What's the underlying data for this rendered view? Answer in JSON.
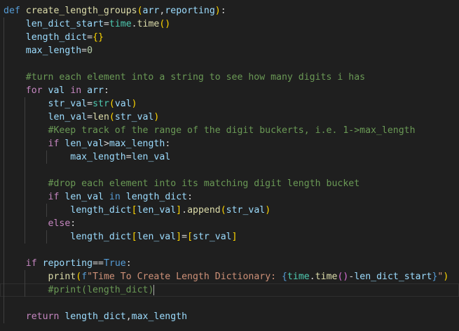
{
  "colors": {
    "background": "#1f1f1f",
    "keyword": "#569cd6",
    "control": "#c586c0",
    "function": "#dcdcaa",
    "variable": "#9cdcfe",
    "plain": "#d4d4d4",
    "string": "#ce9178",
    "number": "#b5cea8",
    "comment": "#6a9955",
    "bracket1": "#ffd700",
    "bracket2": "#da70d6",
    "bracket3": "#179fff",
    "type": "#4ec9b0"
  },
  "editor": {
    "language": "python",
    "cursor_line": 22,
    "lines": [
      {
        "indent": 0,
        "tokens": [
          {
            "t": "def",
            "c": "keyword"
          },
          {
            "t": " ",
            "c": "plain"
          },
          {
            "t": "create_length_groups",
            "c": "function"
          },
          {
            "t": "(",
            "c": "bracket1"
          },
          {
            "t": "arr",
            "c": "variable"
          },
          {
            "t": ",",
            "c": "plain"
          },
          {
            "t": "reporting",
            "c": "variable"
          },
          {
            "t": ")",
            "c": "bracket1"
          },
          {
            "t": ":",
            "c": "plain"
          }
        ]
      },
      {
        "indent": 1,
        "tokens": [
          {
            "t": "len_dict_start",
            "c": "variable"
          },
          {
            "t": "=",
            "c": "plain"
          },
          {
            "t": "time",
            "c": "type"
          },
          {
            "t": ".",
            "c": "plain"
          },
          {
            "t": "time",
            "c": "function"
          },
          {
            "t": "()",
            "c": "bracket1"
          }
        ]
      },
      {
        "indent": 1,
        "tokens": [
          {
            "t": "length_dict",
            "c": "variable"
          },
          {
            "t": "=",
            "c": "plain"
          },
          {
            "t": "{}",
            "c": "bracket1"
          }
        ]
      },
      {
        "indent": 1,
        "tokens": [
          {
            "t": "max_length",
            "c": "variable"
          },
          {
            "t": "=",
            "c": "plain"
          },
          {
            "t": "0",
            "c": "number"
          }
        ]
      },
      {
        "indent": 1,
        "tokens": []
      },
      {
        "indent": 1,
        "tokens": [
          {
            "t": "#turn each element into a string to see how many digits i has",
            "c": "comment"
          }
        ]
      },
      {
        "indent": 1,
        "tokens": [
          {
            "t": "for",
            "c": "control"
          },
          {
            "t": " ",
            "c": "plain"
          },
          {
            "t": "val",
            "c": "variable"
          },
          {
            "t": " ",
            "c": "plain"
          },
          {
            "t": "in",
            "c": "control"
          },
          {
            "t": " ",
            "c": "plain"
          },
          {
            "t": "arr",
            "c": "variable"
          },
          {
            "t": ":",
            "c": "plain"
          }
        ]
      },
      {
        "indent": 2,
        "tokens": [
          {
            "t": "str_val",
            "c": "variable"
          },
          {
            "t": "=",
            "c": "plain"
          },
          {
            "t": "str",
            "c": "type"
          },
          {
            "t": "(",
            "c": "bracket1"
          },
          {
            "t": "val",
            "c": "variable"
          },
          {
            "t": ")",
            "c": "bracket1"
          }
        ]
      },
      {
        "indent": 2,
        "tokens": [
          {
            "t": "len_val",
            "c": "variable"
          },
          {
            "t": "=",
            "c": "plain"
          },
          {
            "t": "len",
            "c": "function"
          },
          {
            "t": "(",
            "c": "bracket1"
          },
          {
            "t": "str_val",
            "c": "variable"
          },
          {
            "t": ")",
            "c": "bracket1"
          }
        ]
      },
      {
        "indent": 2,
        "tokens": [
          {
            "t": "#Keep track of the range of the digit buckerts, i.e. 1->max_length",
            "c": "comment"
          }
        ]
      },
      {
        "indent": 2,
        "tokens": [
          {
            "t": "if",
            "c": "control"
          },
          {
            "t": " ",
            "c": "plain"
          },
          {
            "t": "len_val",
            "c": "variable"
          },
          {
            "t": ">",
            "c": "plain"
          },
          {
            "t": "max_length",
            "c": "variable"
          },
          {
            "t": ":",
            "c": "plain"
          }
        ]
      },
      {
        "indent": 3,
        "tokens": [
          {
            "t": "max_length",
            "c": "variable"
          },
          {
            "t": "=",
            "c": "plain"
          },
          {
            "t": "len_val",
            "c": "variable"
          }
        ]
      },
      {
        "indent": 2,
        "tokens": []
      },
      {
        "indent": 2,
        "tokens": [
          {
            "t": "#drop each element into its matching digit length bucket",
            "c": "comment"
          }
        ]
      },
      {
        "indent": 2,
        "tokens": [
          {
            "t": "if",
            "c": "control"
          },
          {
            "t": " ",
            "c": "plain"
          },
          {
            "t": "len_val",
            "c": "variable"
          },
          {
            "t": " ",
            "c": "plain"
          },
          {
            "t": "in",
            "c": "keyword"
          },
          {
            "t": " ",
            "c": "plain"
          },
          {
            "t": "length_dict",
            "c": "variable"
          },
          {
            "t": ":",
            "c": "plain"
          }
        ]
      },
      {
        "indent": 3,
        "tokens": [
          {
            "t": "length_dict",
            "c": "variable"
          },
          {
            "t": "[",
            "c": "bracket1"
          },
          {
            "t": "len_val",
            "c": "variable"
          },
          {
            "t": "]",
            "c": "bracket1"
          },
          {
            "t": ".",
            "c": "plain"
          },
          {
            "t": "append",
            "c": "function"
          },
          {
            "t": "(",
            "c": "bracket1"
          },
          {
            "t": "str_val",
            "c": "variable"
          },
          {
            "t": ")",
            "c": "bracket1"
          }
        ]
      },
      {
        "indent": 2,
        "tokens": [
          {
            "t": "else",
            "c": "control"
          },
          {
            "t": ":",
            "c": "plain"
          }
        ]
      },
      {
        "indent": 3,
        "tokens": [
          {
            "t": "length_dict",
            "c": "variable"
          },
          {
            "t": "[",
            "c": "bracket1"
          },
          {
            "t": "len_val",
            "c": "variable"
          },
          {
            "t": "]",
            "c": "bracket1"
          },
          {
            "t": "=",
            "c": "plain"
          },
          {
            "t": "[",
            "c": "bracket1"
          },
          {
            "t": "str_val",
            "c": "variable"
          },
          {
            "t": "]",
            "c": "bracket1"
          }
        ]
      },
      {
        "indent": 1,
        "tokens": []
      },
      {
        "indent": 1,
        "tokens": [
          {
            "t": "if",
            "c": "control"
          },
          {
            "t": " ",
            "c": "plain"
          },
          {
            "t": "reporting",
            "c": "variable"
          },
          {
            "t": "==",
            "c": "plain"
          },
          {
            "t": "True",
            "c": "keyword"
          },
          {
            "t": ":",
            "c": "plain"
          }
        ]
      },
      {
        "indent": 2,
        "tokens": [
          {
            "t": "print",
            "c": "function"
          },
          {
            "t": "(",
            "c": "bracket1"
          },
          {
            "t": "f",
            "c": "keyword"
          },
          {
            "t": "\"Time To Create Length Dictionary: ",
            "c": "string"
          },
          {
            "t": "{",
            "c": "keyword"
          },
          {
            "t": "time",
            "c": "type"
          },
          {
            "t": ".",
            "c": "plain"
          },
          {
            "t": "time",
            "c": "function"
          },
          {
            "t": "()",
            "c": "bracket2"
          },
          {
            "t": "-",
            "c": "plain"
          },
          {
            "t": "len_dict_start",
            "c": "variable"
          },
          {
            "t": "}",
            "c": "keyword"
          },
          {
            "t": "\"",
            "c": "string"
          },
          {
            "t": ")",
            "c": "bracket1"
          }
        ]
      },
      {
        "indent": 2,
        "tokens": [
          {
            "t": "#print(length_dict)",
            "c": "comment"
          }
        ]
      },
      {
        "indent": 1,
        "tokens": []
      },
      {
        "indent": 1,
        "tokens": [
          {
            "t": "return",
            "c": "control"
          },
          {
            "t": " ",
            "c": "plain"
          },
          {
            "t": "length_dict",
            "c": "variable"
          },
          {
            "t": ",",
            "c": "plain"
          },
          {
            "t": "max_length",
            "c": "variable"
          }
        ]
      }
    ]
  }
}
